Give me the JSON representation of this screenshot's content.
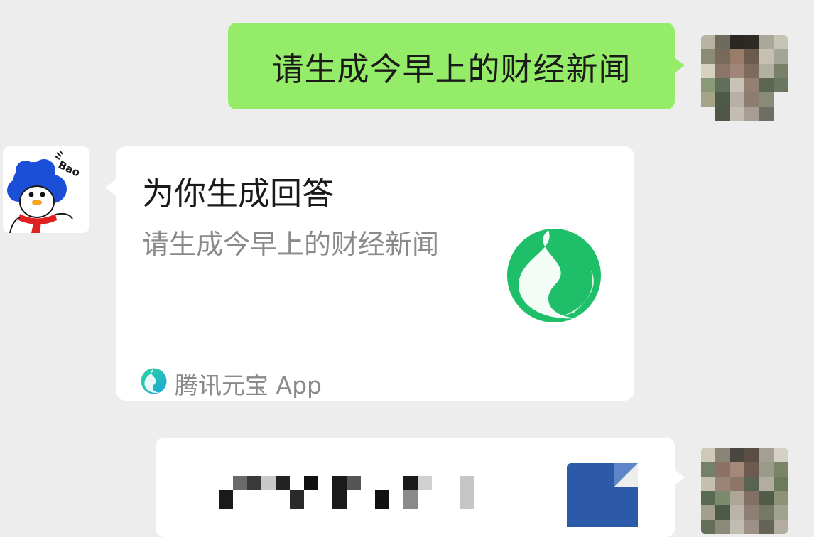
{
  "conversation": {
    "user_message": "请生成今早上的财经新闻",
    "bot_card": {
      "title": "为你生成回答",
      "subtitle": "请生成今早上的财经新闻",
      "app_name": "腾讯元宝 App",
      "logo": "yuanbao-logo-icon"
    },
    "bot_avatar_badge": "Bao",
    "file_message": {
      "icon": "word-document-icon"
    }
  },
  "colors": {
    "background": "#ededed",
    "user_bubble": "#95ec69",
    "card": "#ffffff",
    "brand_green": "#1fbf6a",
    "doc_blue": "#2c5aa8"
  }
}
